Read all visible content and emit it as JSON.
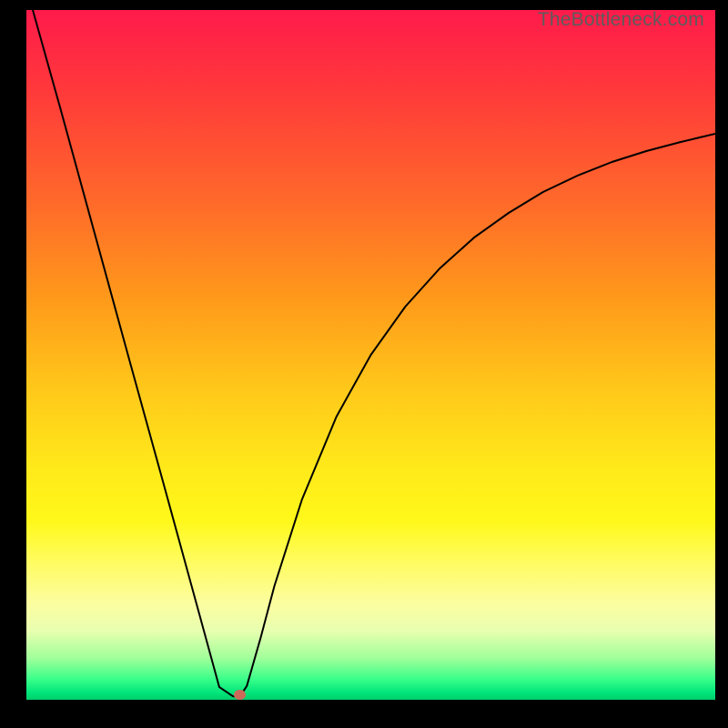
{
  "watermark": "TheBottleneck.com",
  "colors": {
    "frame_bg": "#000000",
    "marker": "#cc6a5a",
    "curve": "#000000",
    "gradient_top": "#ff1a4b",
    "gradient_bottom": "#00cc6a"
  },
  "chart_data": {
    "type": "line",
    "title": "",
    "xlabel": "",
    "ylabel": "",
    "xlim": [
      0,
      100
    ],
    "ylim": [
      0,
      100
    ],
    "grid": false,
    "series": [
      {
        "name": "bottleneck-curve-left",
        "x": [
          0.9,
          5,
          10,
          15,
          20,
          25,
          28,
          30,
          31
        ],
        "y": [
          100,
          85.5,
          67.3,
          49.1,
          31.0,
          12.8,
          1.9,
          0.5,
          0.5
        ]
      },
      {
        "name": "bottleneck-curve-right",
        "x": [
          31,
          32,
          34,
          36,
          40,
          45,
          50,
          55,
          60,
          65,
          70,
          75,
          80,
          85,
          90,
          95,
          100
        ],
        "y": [
          0.5,
          2.0,
          9.0,
          16.5,
          29.0,
          41.0,
          50.0,
          57.0,
          62.5,
          67.0,
          70.6,
          73.6,
          76.0,
          78.0,
          79.6,
          80.9,
          82.0
        ]
      }
    ],
    "marker": {
      "x": 31,
      "y": 0.5
    },
    "annotations": []
  }
}
